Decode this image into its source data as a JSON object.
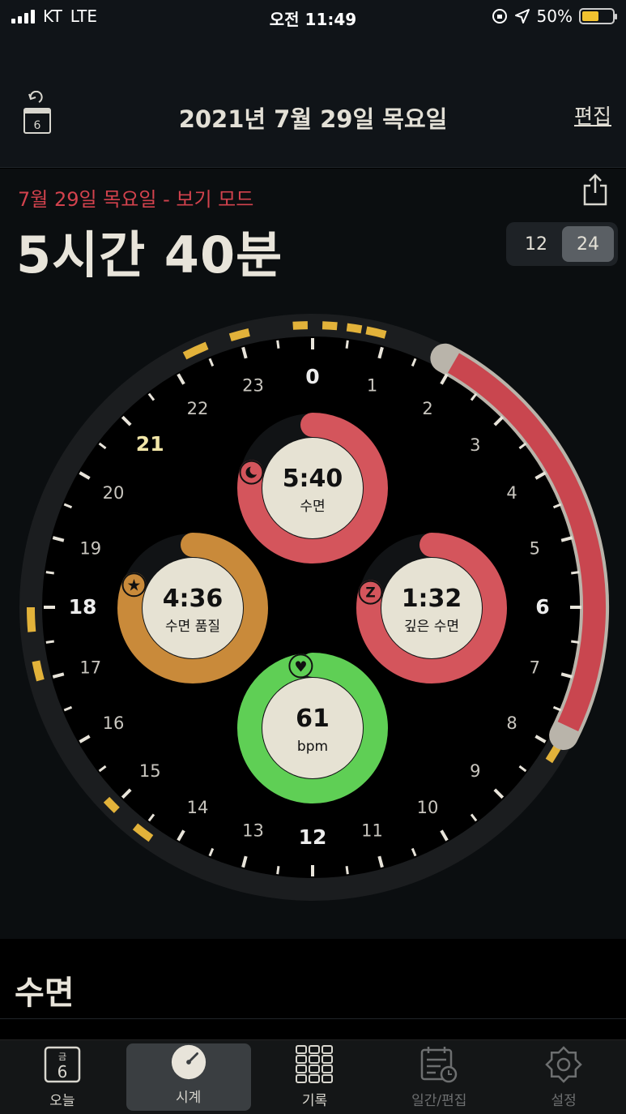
{
  "status": {
    "carrier": "KT",
    "network": "LTE",
    "time": "오전 11:49",
    "battery": "50%"
  },
  "nav": {
    "title": "2021년 7월 29일 목요일",
    "edit": "편집",
    "calendar_day": "6"
  },
  "summary": {
    "date_mode": "7월 29일 목요일 - 보기 모드",
    "duration": "5시간 40분",
    "toggle": [
      "12",
      "24"
    ],
    "active_toggle": "24"
  },
  "clock": {
    "hours": [
      "0",
      "1",
      "2",
      "3",
      "4",
      "5",
      "6",
      "7",
      "8",
      "9",
      "10",
      "11",
      "12",
      "13",
      "14",
      "15",
      "16",
      "17",
      "18",
      "19",
      "20",
      "21",
      "22",
      "23"
    ],
    "rings": {
      "sleep": {
        "value": "5:40",
        "label": "수면",
        "color": "#d4555c",
        "fraction": 0.79
      },
      "quality": {
        "value": "4:36",
        "label": "수면 품질",
        "color": "#c98a3a",
        "fraction": 0.81
      },
      "deep": {
        "value": "1:32",
        "label": "깊은 수면",
        "color": "#d4555c",
        "fraction": 0.79
      },
      "heart": {
        "value": "61",
        "label": "bpm",
        "color": "#5fcf55",
        "fraction": 0.97
      }
    },
    "accent": {
      "sleep_arc": "#c9464f",
      "marks": "#e2b23a"
    }
  },
  "section": {
    "title": "수면"
  },
  "tabs": [
    {
      "label": "오늘",
      "icon": "calendar-today-icon",
      "sub": "금",
      "num": "6"
    },
    {
      "label": "시계",
      "icon": "clock-icon"
    },
    {
      "label": "기록",
      "icon": "grid-icon"
    },
    {
      "label": "일간/편집",
      "icon": "calendar-edit-icon"
    },
    {
      "label": "설정",
      "icon": "gear-icon"
    }
  ]
}
